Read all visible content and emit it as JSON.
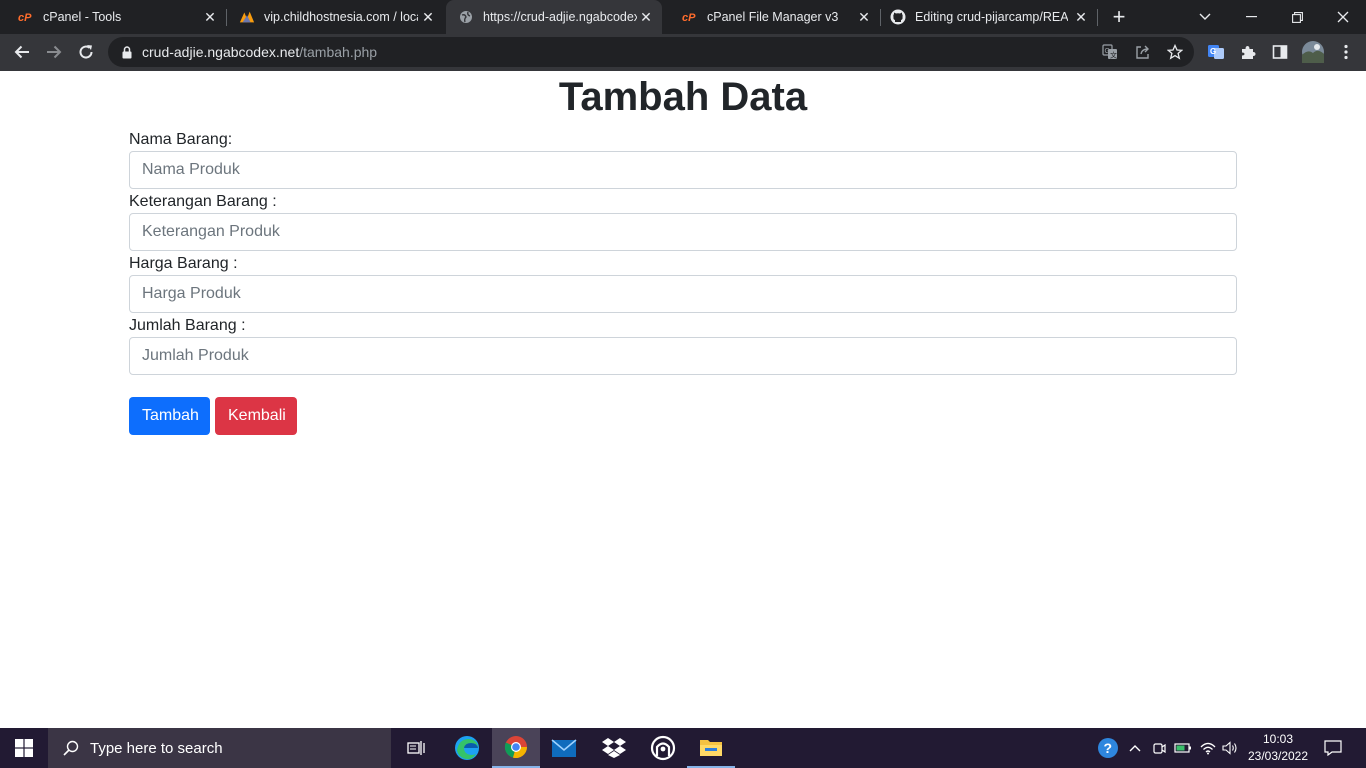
{
  "browser": {
    "tabs": [
      {
        "title": "cPanel - Tools",
        "icon": "cpanel-icon"
      },
      {
        "title": "vip.childhostnesia.com / localh",
        "icon": "phpmyadmin-icon"
      },
      {
        "title": "https://crud-adjie.ngabcodex.n",
        "icon": "globe-icon",
        "active": true
      },
      {
        "title": "cPanel File Manager v3",
        "icon": "cpanel-icon"
      },
      {
        "title": "Editing crud-pijarcamp/READ",
        "icon": "github-icon"
      }
    ],
    "address": {
      "domain": "crud-adjie.ngabcodex.net",
      "path": "/tambah.php"
    }
  },
  "page": {
    "title": "Tambah Data",
    "fields": [
      {
        "label": "Nama Barang:",
        "placeholder": "Nama Produk"
      },
      {
        "label": "Keterangan Barang :",
        "placeholder": "Keterangan Produk"
      },
      {
        "label": "Harga Barang :",
        "placeholder": "Harga Produk"
      },
      {
        "label": "Jumlah Barang :",
        "placeholder": "Jumlah Produk"
      }
    ],
    "submit_label": "Tambah",
    "back_label": "Kembali",
    "colors": {
      "primary": "#0d6efd",
      "danger": "#dc3545"
    }
  },
  "taskbar": {
    "search_placeholder": "Type here to search",
    "time": "10:03",
    "date": "23/03/2022"
  }
}
